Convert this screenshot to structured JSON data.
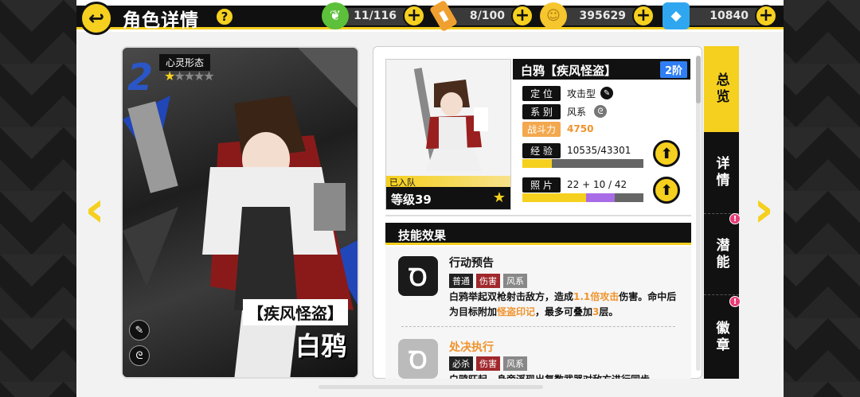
{
  "header": {
    "back_icon": "back-arrow-icon",
    "title": "角色详情",
    "help": "?"
  },
  "resources": [
    {
      "icon": "leaf-energy-icon",
      "value": "11/116",
      "color": "#5cc03a"
    },
    {
      "icon": "battery-icon",
      "value": "8/100",
      "color": "#f0a030"
    },
    {
      "icon": "coin-icon",
      "value": "395629",
      "color": "#f5c62e"
    },
    {
      "icon": "crystal-icon",
      "value": "10840",
      "color": "#2fa7f0"
    }
  ],
  "card": {
    "number": "2",
    "form_label": "心灵形态",
    "stars_filled": 1,
    "stars_total": 5,
    "subtitle": "【疾风怪盗】",
    "name": "白鸦"
  },
  "info": {
    "name": "白鸦【疾风怪盗】",
    "rank": "2阶",
    "joined": "已入队",
    "level": "等级39",
    "position_label": "定 位",
    "position_value": "攻击型",
    "element_label": "系 别",
    "element_value": "风系",
    "power_label": "战斗力",
    "power_value": "4750",
    "exp_label": "经 验",
    "exp_value": "10535/43301",
    "exp_fraction": 0.243,
    "photo_label": "照 片",
    "photo_value": "22 + 10 / 42",
    "photo_fraction_base": 0.524,
    "photo_fraction_bonus": 0.238
  },
  "skills": {
    "header": "技能效果",
    "items": [
      {
        "name": "行动预告",
        "tags": [
          {
            "label": "普通",
            "color": "#222"
          },
          {
            "label": "伤害",
            "color": "#a0282c"
          },
          {
            "label": "风系",
            "color": "#888"
          }
        ],
        "desc_parts": [
          "白鸦举起双枪射击敌方，造成",
          "1.1倍攻击",
          "伤害。命中后为目标附加",
          "怪盗印记",
          "，最多可叠加",
          "3",
          "层。"
        ]
      },
      {
        "name": "处决执行",
        "tags": [
          {
            "label": "必杀",
            "color": "#222"
          },
          {
            "label": "伤害",
            "color": "#a0282c"
          },
          {
            "label": "风系",
            "color": "#888"
          }
        ],
        "desc_parts": [
          "白鸦旺起，身旁浮现出复数武器对敌方进行同步"
        ]
      }
    ]
  },
  "tabs": [
    {
      "label": "总览",
      "active": true,
      "badge": false
    },
    {
      "label": "详情",
      "active": false,
      "badge": true
    },
    {
      "label": "潜能",
      "active": false,
      "badge": true
    },
    {
      "label": "徽章",
      "active": false,
      "badge": false
    }
  ],
  "colors": {
    "accent": "#f5d01e",
    "rank_blue": "#2f7ef5",
    "exp_fill": "#f5d01e",
    "photo_bonus": "#a86ce6"
  }
}
